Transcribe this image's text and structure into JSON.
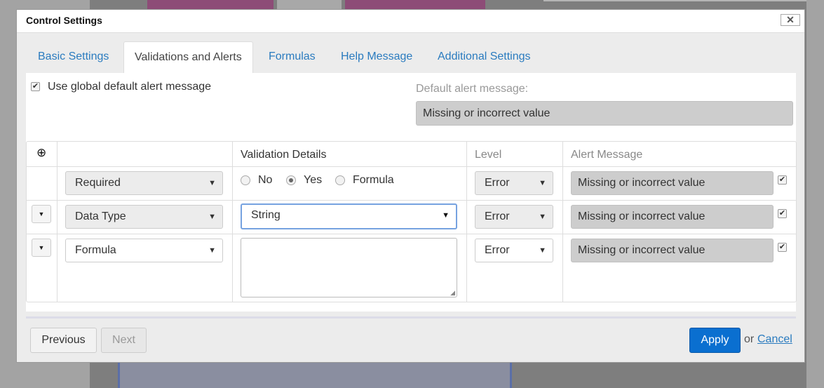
{
  "dialog": {
    "title": "Control Settings",
    "close_symbol": "✕"
  },
  "tabs": [
    {
      "label": "Basic Settings",
      "active": false
    },
    {
      "label": "Validations and Alerts",
      "active": true
    },
    {
      "label": "Formulas",
      "active": false
    },
    {
      "label": "Help Message",
      "active": false
    },
    {
      "label": "Additional Settings",
      "active": false
    }
  ],
  "global_alert": {
    "checkbox_label": "Use global default alert message",
    "checked": true,
    "default_label": "Default alert message:",
    "default_value": "Missing or incorrect value"
  },
  "grid": {
    "headers": {
      "add": "⊕",
      "details": "Validation Details",
      "level": "Level",
      "alert": "Alert Message"
    },
    "rows": [
      {
        "type": "Required",
        "radios": [
          {
            "label": "No",
            "selected": false
          },
          {
            "label": "Yes",
            "selected": true
          },
          {
            "label": "Formula",
            "selected": false
          }
        ],
        "level": "Error",
        "alert": "Missing or incorrect value",
        "alert_checked": true
      },
      {
        "type": "Data Type",
        "detail_select": "String",
        "level": "Error",
        "alert": "Missing or incorrect value",
        "alert_checked": true
      },
      {
        "type": "Formula",
        "detail_text": "",
        "level": "Error",
        "alert": "Missing or incorrect value",
        "alert_checked": true
      }
    ]
  },
  "footer": {
    "previous": "Previous",
    "next": "Next",
    "apply": "Apply",
    "or": "or",
    "cancel": "Cancel"
  },
  "colors": {
    "link": "#2a7bbf",
    "primary": "#0a6fd0"
  }
}
